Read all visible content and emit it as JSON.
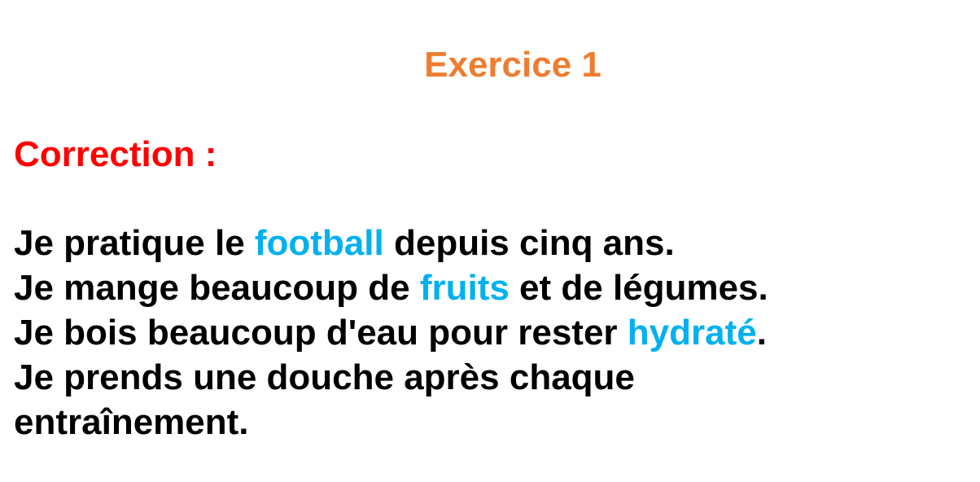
{
  "title": "Exercice 1",
  "correction_label": "Correction :",
  "sentences": [
    {
      "before": "Je pratique le ",
      "answer": "football",
      "after": " depuis cinq ans."
    },
    {
      "before": "Je mange beaucoup de ",
      "answer": "fruits",
      "after": " et de légumes."
    },
    {
      "before": "Je bois beaucoup d'eau pour rester ",
      "answer": "hydraté",
      "after": "."
    },
    {
      "line": "Je prends une douche après chaque"
    },
    {
      "line": "entraînement."
    }
  ],
  "colors": {
    "title": "#ED7D31",
    "correction": "#FF0000",
    "answer": "#00B0F0",
    "text": "#000000"
  }
}
